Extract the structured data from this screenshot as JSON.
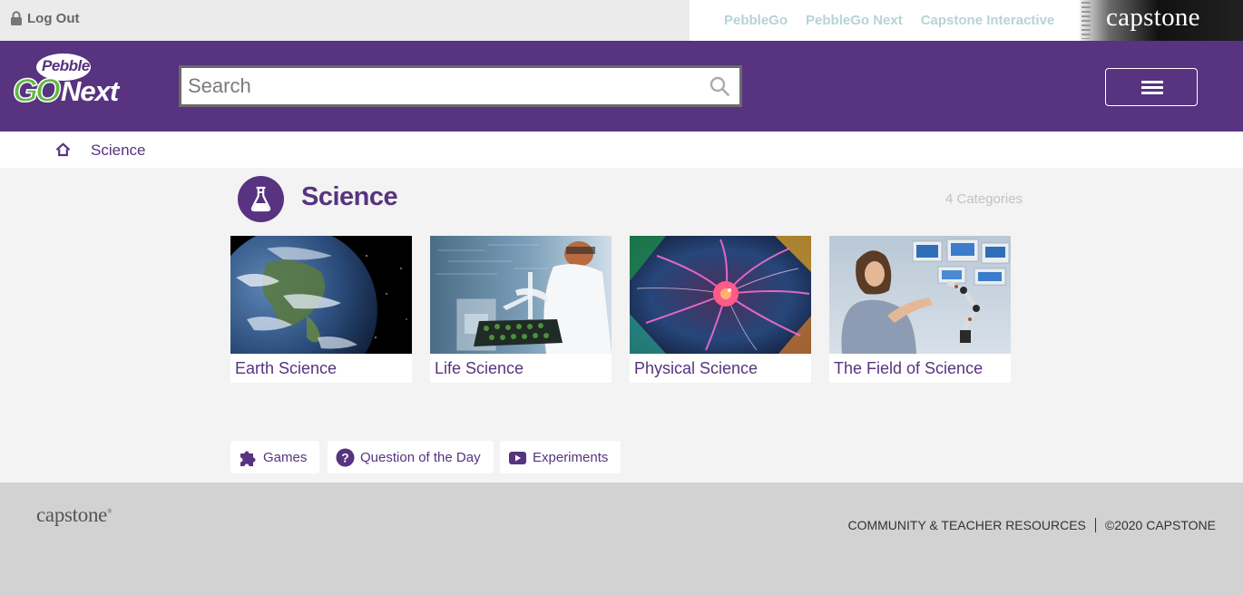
{
  "topbar": {
    "logout_label": "Log Out",
    "links": [
      "PebbleGo",
      "PebbleGo Next",
      "Capstone Interactive"
    ],
    "brand": "capstone"
  },
  "header": {
    "logo": {
      "pebble": "Pebble",
      "go": "GO",
      "next": "Next"
    },
    "search_placeholder": "Search"
  },
  "breadcrumb": {
    "current": "Science"
  },
  "main": {
    "title": "Science",
    "count": "4 Categories",
    "cards": [
      {
        "label": "Earth Science"
      },
      {
        "label": "Life Science"
      },
      {
        "label": "Physical Science"
      },
      {
        "label": "The Field of Science"
      }
    ],
    "chips": [
      {
        "label": "Games",
        "icon": "puzzle-icon"
      },
      {
        "label": "Question of the Day",
        "icon": "question-circle-icon"
      },
      {
        "label": "Experiments",
        "icon": "video-play-icon"
      }
    ]
  },
  "footer": {
    "brand": "capstone",
    "resources": "COMMUNITY & TEACHER RESOURCES",
    "copyright": "©2020 CAPSTONE"
  },
  "colors": {
    "brand_purple": "#573380",
    "green": "#63b845",
    "footer_bg": "#d2d2d2"
  }
}
